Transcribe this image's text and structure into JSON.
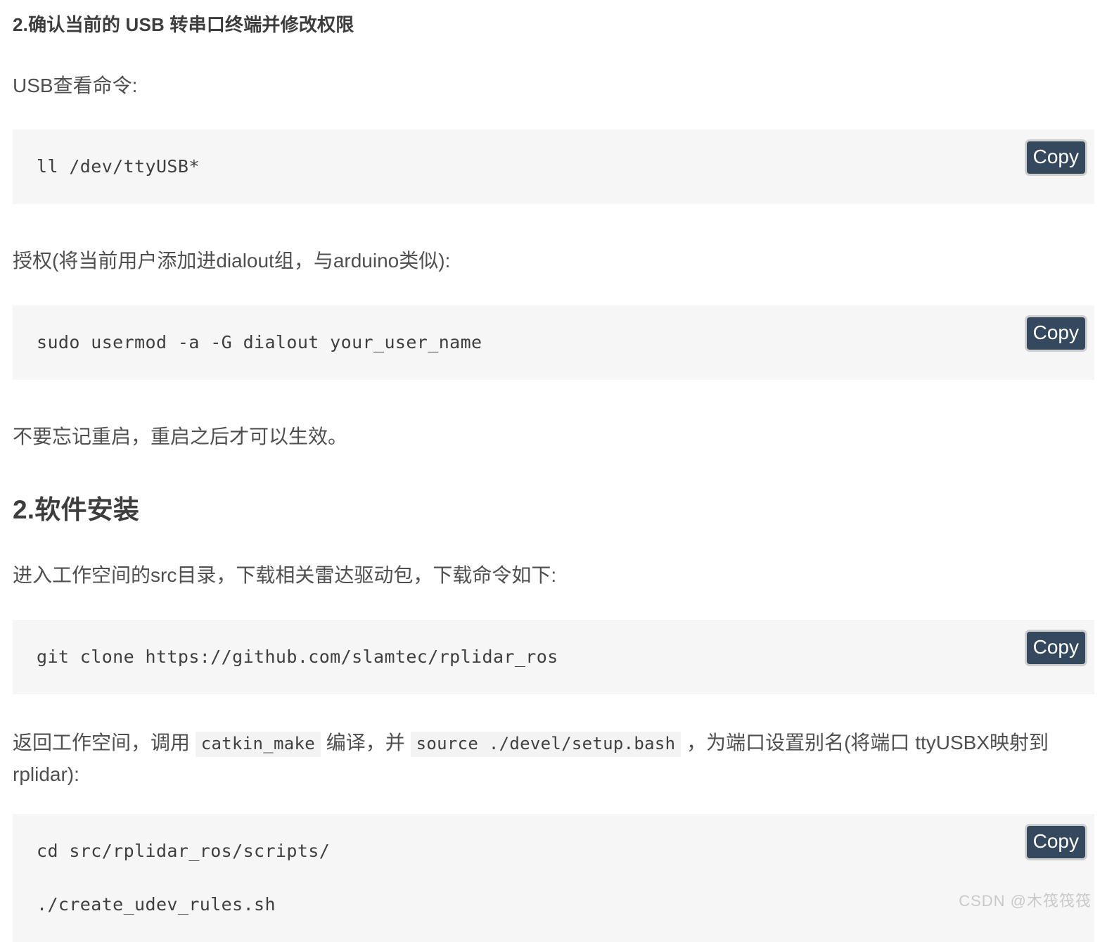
{
  "document": {
    "section_heading": "2.确认当前的 USB 转串口终端并修改权限",
    "main_heading": "2.软件安装",
    "paragraphs": {
      "usb_check": "USB查看命令:",
      "authorize": "授权(将当前用户添加进dialout组，与arduino类似):",
      "reboot_note": "不要忘记重启，重启之后才可以生效。",
      "src_download": "进入工作空间的src目录，下载相关雷达驱动包，下载命令如下:",
      "catkin_line1_part1": "返回工作空间，调用 ",
      "catkin_line1_code1": "catkin_make",
      "catkin_line1_part2": " 编译，并 ",
      "catkin_line1_code2": "source ./devel/setup.bash",
      "catkin_line1_part3": " ，为端口设置别名(将端口 ttyUSBX",
      "catkin_line2": "映射到 rplidar):"
    },
    "code_blocks": [
      {
        "id": "usb-list",
        "code": "ll /dev/ttyUSB*",
        "copy_label": "Copy"
      },
      {
        "id": "usermod-dialout",
        "code": "sudo usermod -a -G dialout your_user_name",
        "copy_label": "Copy"
      },
      {
        "id": "git-clone-rplidar",
        "code": "git clone https://github.com/slamtec/rplidar_ros",
        "copy_label": "Copy"
      },
      {
        "id": "create-udev-rules",
        "code": "cd src/rplidar_ros/scripts/\n\n./create_udev_rules.sh",
        "copy_label": "Copy"
      }
    ],
    "watermark": "CSDN @木筏筏筏"
  },
  "colors": {
    "page_background": "#ffffff",
    "text": "#4f4f4f",
    "heading": "#3d3d3d",
    "code_background": "#f6f6f6",
    "inline_code_background": "#f3f3f3",
    "copy_button_background": "#34495e",
    "copy_button_border": "#cfcfcf",
    "copy_button_text": "#ffffff",
    "watermark": "#c9c9c9"
  }
}
